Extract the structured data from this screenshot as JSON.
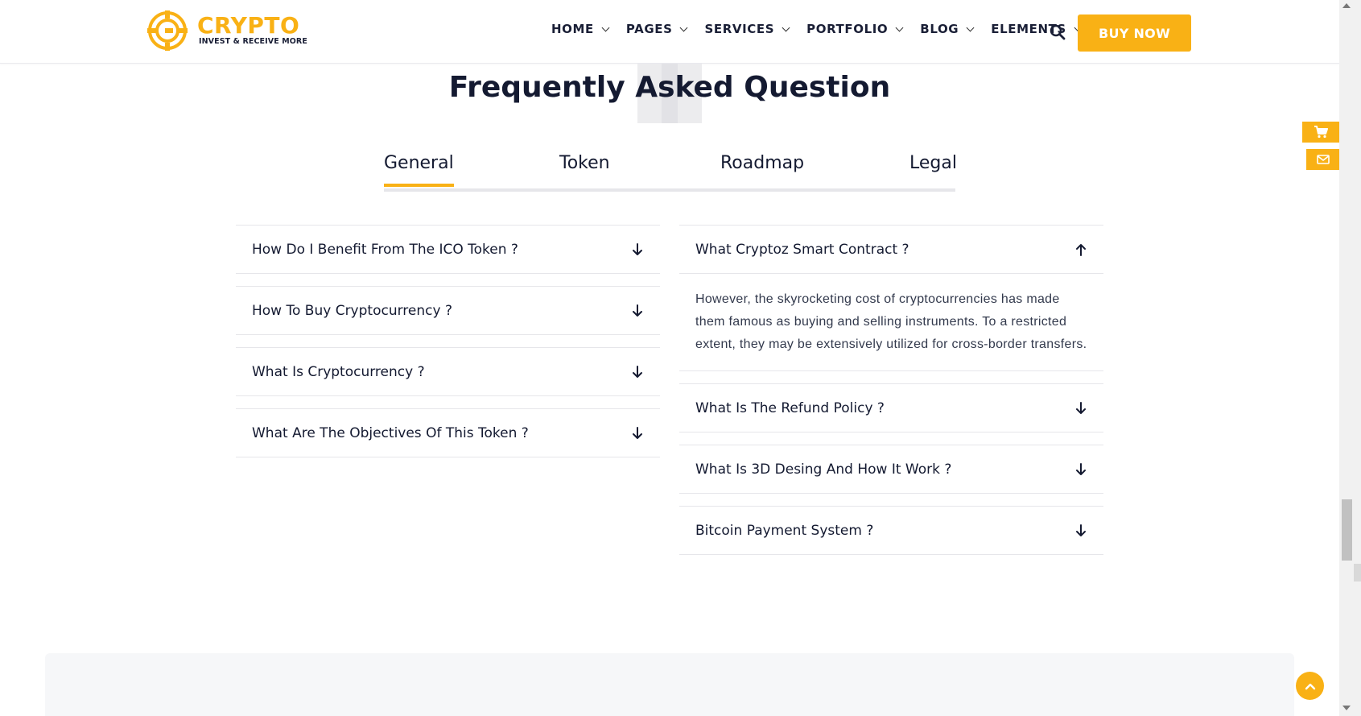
{
  "brand": {
    "name": "CRYPTO",
    "tagline": "INVEST & RECEIVE MORE",
    "accent_color": "#f9b115",
    "dark_color": "#141a31"
  },
  "nav": {
    "items": [
      {
        "label": "HOME",
        "icon": "chevron-down-icon"
      },
      {
        "label": "PAGES",
        "icon": "chevron-down-icon"
      },
      {
        "label": "SERVICES",
        "icon": "chevron-down-icon"
      },
      {
        "label": "PORTFOLIO",
        "icon": "chevron-down-icon"
      },
      {
        "label": "BLOG",
        "icon": "chevron-down-icon"
      },
      {
        "label": "ELEMENTS",
        "icon": "chevron-down-icon"
      }
    ],
    "search_icon": "search-icon",
    "buy_label": "BUY NOW"
  },
  "faq": {
    "title": "Frequently Asked Question",
    "tabs": [
      {
        "label": "General",
        "active": true
      },
      {
        "label": "Token",
        "active": false
      },
      {
        "label": "Roadmap",
        "active": false
      },
      {
        "label": "Legal",
        "active": false
      }
    ],
    "left": [
      {
        "question": "How Do I Benefit From The ICO Token ?",
        "open": false
      },
      {
        "question": "How To Buy Cryptocurrency ?",
        "open": false
      },
      {
        "question": "What Is Cryptocurrency ?",
        "open": false
      },
      {
        "question": "What Are The Objectives Of This Token ?",
        "open": false
      }
    ],
    "right": [
      {
        "question": "What Cryptoz Smart Contract ?",
        "open": true,
        "answer": "However, the skyrocketing cost of cryptocurrencies has made them famous as buying and selling instruments. To a restricted extent, they may be extensively utilized for cross-border transfers."
      },
      {
        "question": "What Is The Refund Policy ?",
        "open": false
      },
      {
        "question": "What Is 3D Desing And How It Work ?",
        "open": false
      },
      {
        "question": "Bitcoin Payment System ?",
        "open": false
      }
    ]
  },
  "floating": {
    "cart_icon": "cart-icon",
    "mail_icon": "mail-icon",
    "to_top_icon": "chevron-up-icon"
  }
}
